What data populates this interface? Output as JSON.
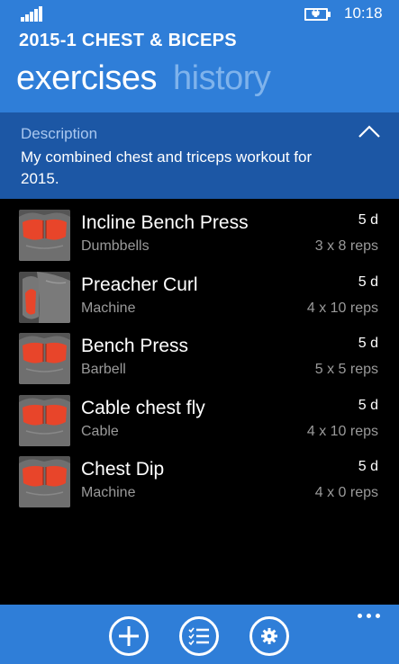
{
  "status_bar": {
    "time": "10:18",
    "signal_icon": "signal-bars-icon",
    "battery_icon": "battery-charging-icon"
  },
  "header": {
    "title": "2015-1 CHEST & BICEPS",
    "tabs": [
      {
        "label": "exercises",
        "active": true
      },
      {
        "label": "history",
        "active": false
      }
    ]
  },
  "description": {
    "label": "Description",
    "text": "My combined chest and triceps workout for 2015.",
    "toggle_icon": "chevron-up-icon"
  },
  "exercises": [
    {
      "name": "Incline Bench Press",
      "equipment": "Dumbbells",
      "days": "5 d",
      "reps": "3 x 8 reps",
      "muscle": "chest"
    },
    {
      "name": "Preacher Curl",
      "equipment": "Machine",
      "days": "5 d",
      "reps": "4 x 10 reps",
      "muscle": "biceps"
    },
    {
      "name": "Bench Press",
      "equipment": "Barbell",
      "days": "5 d",
      "reps": "5 x 5 reps",
      "muscle": "chest"
    },
    {
      "name": "Cable chest fly",
      "equipment": "Cable",
      "days": "5 d",
      "reps": "4 x 10 reps",
      "muscle": "chest"
    },
    {
      "name": "Chest Dip",
      "equipment": "Machine",
      "days": "5 d",
      "reps": "4 x 0 reps",
      "muscle": "chest"
    }
  ],
  "app_bar": {
    "buttons": [
      {
        "icon": "add-icon"
      },
      {
        "icon": "checklist-icon"
      },
      {
        "icon": "settings-gear-icon"
      }
    ],
    "more_icon": "more-ellipsis-icon"
  },
  "colors": {
    "accent": "#2f7ed8",
    "description_bg": "#1c57a5",
    "inactive_tab": "#7fb3ec",
    "secondary_text": "#9a9a9a",
    "muscle_highlight": "#e8452a"
  }
}
